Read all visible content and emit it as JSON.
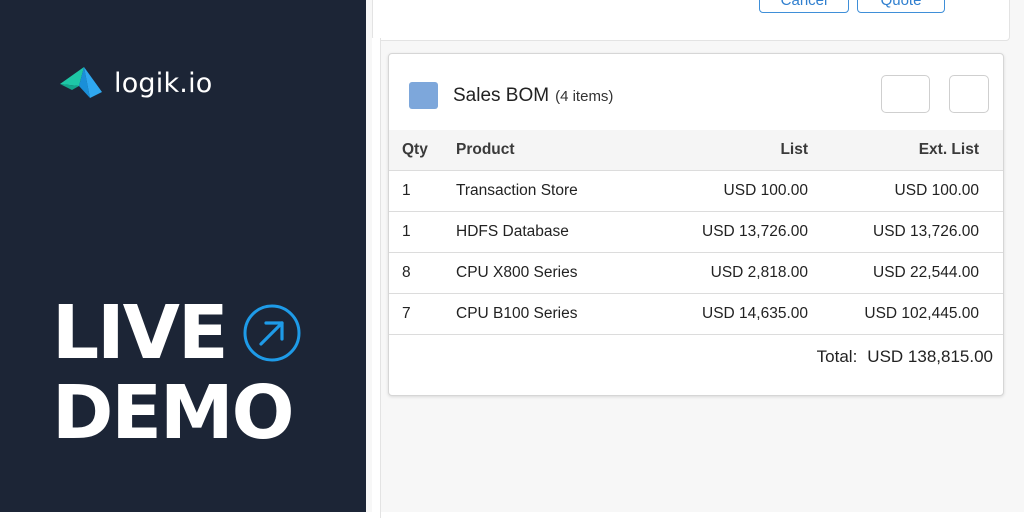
{
  "brand": {
    "logo_text": "logik.io",
    "headline_line1": "LIVE",
    "headline_line2": "DEMO",
    "panel_color": "#1c2536",
    "accent_color": "#1e9be8"
  },
  "actions": {
    "cancel_label": "Cancel",
    "quote_label": "Quote"
  },
  "bom": {
    "title": "Sales BOM",
    "count": "(4 items)",
    "swatch_color": "#7da7db",
    "columns": [
      "Qty",
      "Product",
      "List",
      "Ext. List"
    ],
    "rows": [
      {
        "qty": "1",
        "product": "Transaction Store",
        "list": "USD 100.00",
        "ext": "USD 100.00"
      },
      {
        "qty": "1",
        "product": "HDFS Database",
        "list": "USD 13,726.00",
        "ext": "USD 13,726.00"
      },
      {
        "qty": "8",
        "product": "CPU X800 Series",
        "list": "USD 2,818.00",
        "ext": "USD 22,544.00"
      },
      {
        "qty": "7",
        "product": "CPU B100 Series",
        "list": "USD 14,635.00",
        "ext": "USD 102,445.00"
      }
    ],
    "total_label": "Total:",
    "total_value": "USD 138,815.00"
  }
}
